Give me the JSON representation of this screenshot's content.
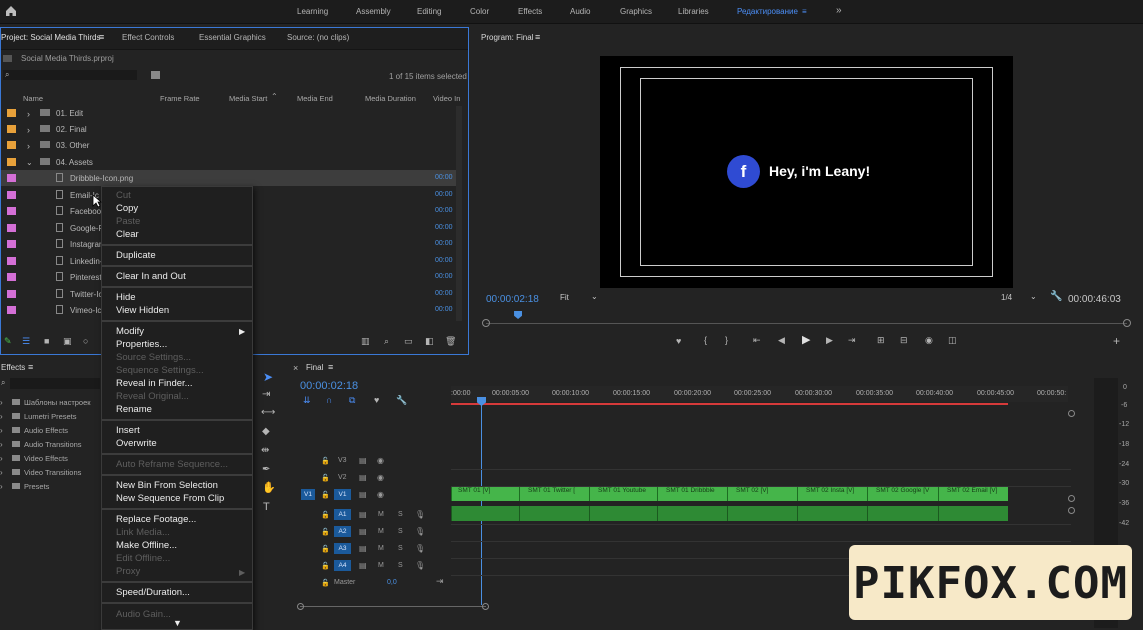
{
  "workspaces": [
    "Learning",
    "Assembly",
    "Editing",
    "Color",
    "Effects",
    "Audio",
    "Graphics",
    "Libraries",
    "Редактирование"
  ],
  "project_panel": {
    "tabs": [
      "Project: Social Media Thirds",
      "Effect Controls",
      "Essential Graphics",
      "Source: (no clips)"
    ],
    "file": "Social Media Thirds.prproj",
    "selection_count": "1 of 15 items selected",
    "columns": [
      "Name",
      "Frame Rate",
      "Media Start",
      "Media End",
      "Media Duration",
      "Video In"
    ],
    "folders": [
      "01. Edit",
      "02. Final",
      "03. Other",
      "04. Assets"
    ],
    "files": [
      "Dribbble-Icon.png",
      "Email-Ic",
      "Facebook",
      "Google-P",
      "Instagram",
      "Linkedin-",
      "Pinterest",
      "Twitter-Ic",
      "Vimeo-Ic"
    ],
    "timecode_col": "00:00"
  },
  "context_menu": [
    {
      "label": "Cut",
      "enabled": false
    },
    {
      "label": "Copy",
      "enabled": true
    },
    {
      "label": "Paste",
      "enabled": false
    },
    {
      "label": "Clear",
      "enabled": true
    },
    {
      "label": "Duplicate",
      "enabled": true
    },
    {
      "label": "Clear In and Out",
      "enabled": true
    },
    {
      "label": "Hide",
      "enabled": true
    },
    {
      "label": "View Hidden",
      "enabled": true
    },
    {
      "label": "Modify",
      "enabled": true
    },
    {
      "label": "Properties...",
      "enabled": true
    },
    {
      "label": "Source Settings...",
      "enabled": false
    },
    {
      "label": "Sequence Settings...",
      "enabled": false
    },
    {
      "label": "Reveal in Finder...",
      "enabled": true
    },
    {
      "label": "Reveal Original...",
      "enabled": false
    },
    {
      "label": "Rename",
      "enabled": true
    },
    {
      "label": "Insert",
      "enabled": true
    },
    {
      "label": "Overwrite",
      "enabled": true
    },
    {
      "label": "Auto Reframe Sequence...",
      "enabled": false
    },
    {
      "label": "New Bin From Selection",
      "enabled": true
    },
    {
      "label": "New Sequence From Clip",
      "enabled": true
    },
    {
      "label": "Replace Footage...",
      "enabled": true
    },
    {
      "label": "Link Media...",
      "enabled": false
    },
    {
      "label": "Make Offline...",
      "enabled": true
    },
    {
      "label": "Edit Offline...",
      "enabled": false
    },
    {
      "label": "Proxy",
      "enabled": false
    },
    {
      "label": "Speed/Duration...",
      "enabled": true
    },
    {
      "label": "Audio Gain...",
      "enabled": false
    }
  ],
  "effects_panel": {
    "title": "Effects",
    "items": [
      "Шаблоны настроек",
      "Lumetri Presets",
      "Audio Effects",
      "Audio Transitions",
      "Video Effects",
      "Video Transitions",
      "Presets"
    ]
  },
  "program": {
    "title": "Program: Final",
    "overlay_text": "Hey, i'm Leany!",
    "overlay_icon_letter": "f",
    "timecode": "00:00:02:18",
    "fit": "Fit",
    "resolution": "1/4",
    "duration": "00:00:46:03",
    "playhead_fraction": 0.05
  },
  "timeline": {
    "title": "Final",
    "timecode": "00:00:02:18",
    "ruler": [
      ":00:00",
      "00:00:05:00",
      "00:00:10:00",
      "00:00:15:00",
      "00:00:20:00",
      "00:00:25:00",
      "00:00:30:00",
      "00:00:35:00",
      "00:00:40:00",
      "00:00:45:00",
      "00:00:50:"
    ],
    "video_tracks": [
      "V3",
      "V2",
      "V1"
    ],
    "audio_tracks": [
      "A1",
      "A2",
      "A3",
      "A4"
    ],
    "master": "Master",
    "master_value": "0,0",
    "track_m": "M",
    "track_s": "S",
    "source_patch": "V1",
    "clips": [
      "SMT 01 [V]",
      "SMT 01 Twitter [",
      "SMT 01 Youtube",
      "SMT 01 Dribbble",
      "SMT 02 [V]",
      "SMT 02 Insta [V]",
      "SMT 02 Google [V",
      "SMT 02 Email [V]"
    ]
  },
  "watermark": "PIKFOX.COM",
  "colors": {
    "accent": "#4b8ef6",
    "clip_green": "#45b54a",
    "timecode_blue": "#4a90e2",
    "label_orange": "#e8a13a",
    "label_pink": "#d46fd6"
  }
}
